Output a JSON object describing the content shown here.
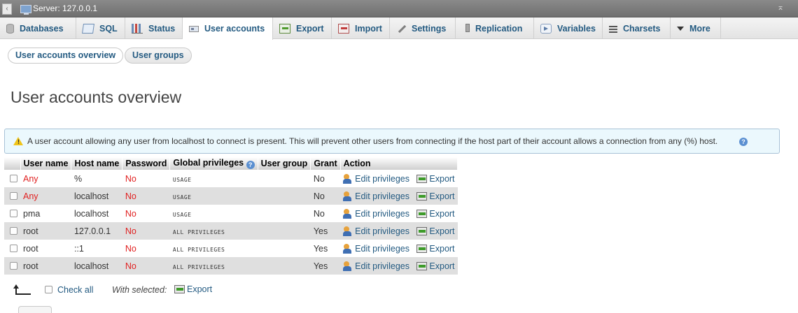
{
  "window": {
    "server_title": "Server: 127.0.0.1"
  },
  "tabs": [
    {
      "label": "Databases",
      "icon": "database-icon"
    },
    {
      "label": "SQL",
      "icon": "sql-icon"
    },
    {
      "label": "Status",
      "icon": "status-icon"
    },
    {
      "label": "User accounts",
      "icon": "users-icon",
      "active": true
    },
    {
      "label": "Export",
      "icon": "export-icon"
    },
    {
      "label": "Import",
      "icon": "import-icon"
    },
    {
      "label": "Settings",
      "icon": "wrench-icon"
    },
    {
      "label": "Replication",
      "icon": "replication-icon"
    },
    {
      "label": "Variables",
      "icon": "variables-icon"
    },
    {
      "label": "Charsets",
      "icon": "charsets-icon"
    },
    {
      "label": "More",
      "icon": "caret-down-icon"
    }
  ],
  "subtabs": [
    "User accounts overview",
    "User groups"
  ],
  "page_title": "User accounts overview",
  "notice": {
    "text": "A user account allowing any user from localhost to connect is present. This will prevent other users from connecting if the host part of their account allows a connection from any (%) host."
  },
  "table": {
    "headers": [
      "User name",
      "Host name",
      "Password",
      "Global privileges",
      "User group",
      "Grant",
      "Action"
    ],
    "rows": [
      {
        "user": "Any",
        "host": "%",
        "password": "No",
        "privileges": "USAGE",
        "group": "",
        "grant": "No"
      },
      {
        "user": "Any",
        "host": "localhost",
        "password": "No",
        "privileges": "USAGE",
        "group": "",
        "grant": "No"
      },
      {
        "user": "pma",
        "host": "localhost",
        "password": "No",
        "privileges": "USAGE",
        "group": "",
        "grant": "No"
      },
      {
        "user": "root",
        "host": "127.0.0.1",
        "password": "No",
        "privileges": "ALL PRIVILEGES",
        "group": "",
        "grant": "Yes"
      },
      {
        "user": "root",
        "host": "::1",
        "password": "No",
        "privileges": "ALL PRIVILEGES",
        "group": "",
        "grant": "Yes"
      },
      {
        "user": "root",
        "host": "localhost",
        "password": "No",
        "privileges": "ALL PRIVILEGES",
        "group": "",
        "grant": "Yes"
      }
    ],
    "edit_label": "Edit privileges",
    "export_label": "Export"
  },
  "footer": {
    "check_all": "Check all",
    "with_selected": "With selected:",
    "export": "Export"
  },
  "colors": {
    "link": "#235a81",
    "no_password": "#e02020",
    "notice_bg": "#ebf8fd"
  }
}
